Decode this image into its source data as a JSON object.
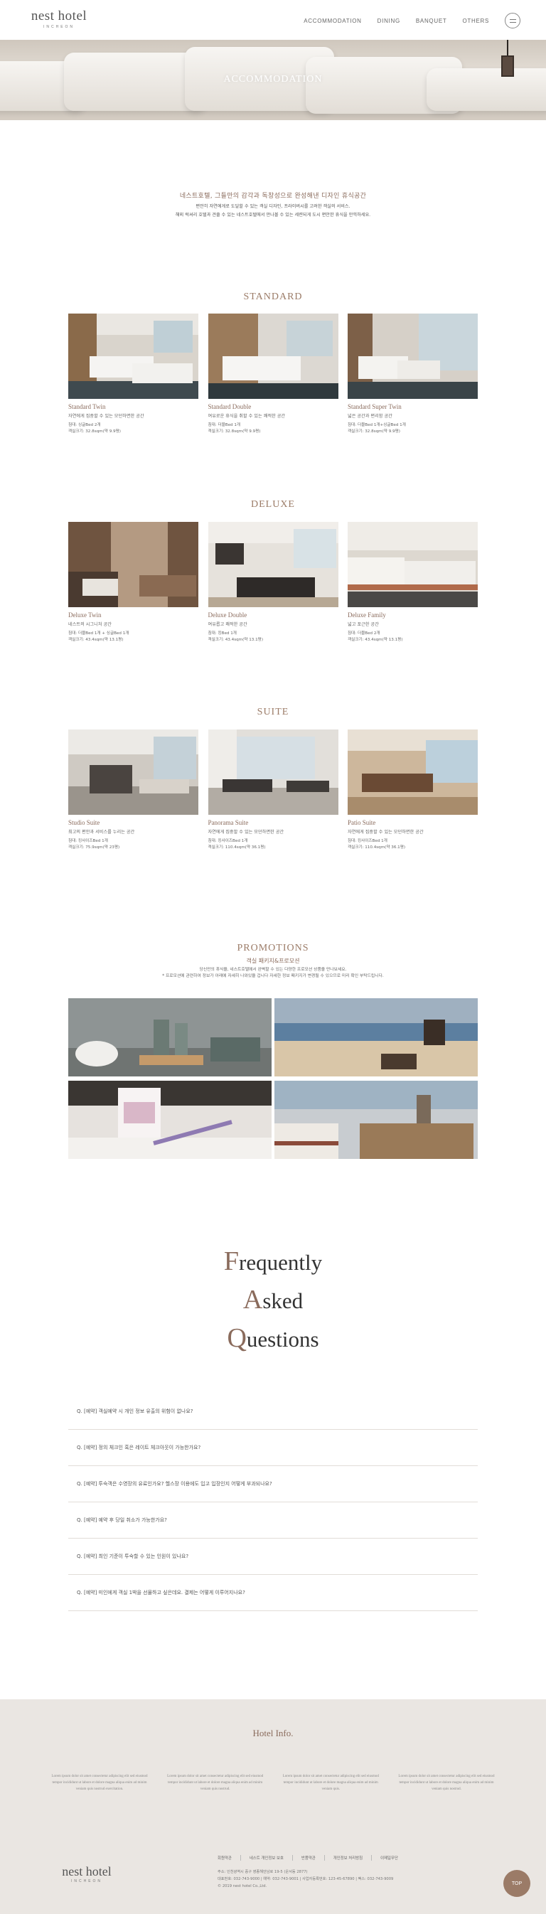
{
  "header": {
    "logo_name": "nest hotel",
    "logo_city": "INCHEON",
    "nav": [
      "ACCOMMODATION",
      "DINING",
      "BANQUET",
      "OTHERS"
    ]
  },
  "hero": {
    "title": "ACCOMMODATION"
  },
  "intro": {
    "heading": "네스트호텔, 그들만의 감각과 독창성으로 완성해낸 디자인 휴식공간",
    "line1": "편안히 자연에게로 도달할 수 있는 객실 디자인, 프라이버시를 고려한 객실의 서비스.",
    "line2": "해외 럭셔리 호텔과 견줄 수 있는 네스트호텔에서 만나볼 수 있는 세련되게 도시 편안한 휴식을 만끽하세요."
  },
  "sections": [
    {
      "title": "STANDARD",
      "rooms": [
        {
          "name": "Standard Twin",
          "desc": "자연에게 집중할 수 있는 모던하면한 공간",
          "bed": "침대: 싱글Bed 2개",
          "size": "객실크기: 32.8sqm(약 9.9평)"
        },
        {
          "name": "Standard Double",
          "desc": "여유로운 휴식을 취할 수 있는 쾌적한 공간",
          "bed": "침대: 더블Bed 1개",
          "size": "객실크기: 32.8sqm(약 9.9평)"
        },
        {
          "name": "Standard Super Twin",
          "desc": "넓은 공간과 편리함 공간",
          "bed": "침대: 더블Bed 1개+싱글Bed 1개",
          "size": "객실크기: 32.8sqm(약 9.9평)"
        }
      ]
    },
    {
      "title": "DELUXE",
      "rooms": [
        {
          "name": "Deluxe Twin",
          "desc": "네스트의 시그니처 공간",
          "bed": "침대: 더블Bed 1개 + 싱글Bed 1개",
          "size": "객실크기: 43.4sqm(약 13.1평)"
        },
        {
          "name": "Deluxe Double",
          "desc": "여유롭고 쾌적한 공간",
          "bed": "침대: 킹Bed 1개",
          "size": "객실크기: 43.4sqm(약 13.1평)"
        },
        {
          "name": "Deluxe Family",
          "desc": "넓고 포근한 공간",
          "bed": "침대: 더블Bed 2개",
          "size": "객실크기: 43.4sqm(약 13.1평)"
        }
      ]
    },
    {
      "title": "SUITE",
      "rooms": [
        {
          "name": "Studio Suite",
          "desc": "최고의 편안과 서비스를 누리는 공간",
          "bed": "침대: 킹사이즈Bed 1개",
          "size": "객실크기: 75.9sqm(약 23평)"
        },
        {
          "name": "Panorama Suite",
          "desc": "자연에게 집중할 수 있는 모던하면한 공간",
          "bed": "침대: 킹사이즈Bed 1개",
          "size": "객실크기: 110.4sqm(약 36.1평)"
        },
        {
          "name": "Patio Suite",
          "desc": "자연에게 집중할 수 있는 모던하면한 공간",
          "bed": "침대: 킹사이즈Bed 1개",
          "size": "객실크기: 110.4sqm(약 36.1평)"
        }
      ]
    }
  ],
  "promotions": {
    "title": "PROMOTIONS",
    "subtitle": "객실 패키지&프로모션",
    "line1": "당신만의 휴식을, 네스트호텔에서 완벽할 수 있는 다양한 프로모션 상품을 만나보세요.",
    "line2": "* 프로모션에 관련하여 정보가 아래에 자세히 나와있을 겁니다 자세한 정보 패키지가 변경될 수 있으므로 미리 확인 부탁드립니다."
  },
  "faq": {
    "title_lines": [
      {
        "cap": "F",
        "rest": "requently"
      },
      {
        "cap": "A",
        "rest": "sked"
      },
      {
        "cap": "Q",
        "rest": "uestions"
      }
    ],
    "items": [
      "Q. [예약] 객실예약 시 개인 정보 유출의 위험이 없나요?",
      "Q. [예약] 정의 체크인 혹은 레이트 체크아웃이 가능한가요?",
      "Q. [예약] 투숙객은 수영장의 유료인가요? 헬스장 이용에도 입고 입장인지 어떻게 부과되나요?",
      "Q. [예약] 예약 후 당일 취소가 가능한가요?",
      "Q. [예약] 최인 기준이 투숙할 수 있는 인원이 있나요?",
      "Q. [예약] 미인에게 객실 1박을 선물하고 싶은데요. 결제는 어떻게 이루어지나요?"
    ]
  },
  "footer": {
    "title": "Hotel Info.",
    "columns": [
      "Lorem ipsum dolor sit amet consectetur adipiscing elit sed eiusmod tempor incididunt ut labore et dolore magna aliqua enim ad minim veniam quis nostrud exercitation.",
      "Lorem ipsum dolor sit amet consectetur adipiscing elit sed eiusmod tempor incididunt ut labore et dolore magna aliqua enim ad minim veniam quis nostrud.",
      "Lorem ipsum dolor sit amet consectetur adipiscing elit sed eiusmod tempor incididunt ut labore et dolore magna aliqua enim ad minim veniam quis.",
      "Lorem ipsum dolor sit amet consectetur adipiscing elit sed eiusmod tempor incididunt ut labore et dolore magna aliqua enim ad minim veniam quis nostrud."
    ],
    "logo_name": "nest hotel",
    "logo_city": "INCHEON",
    "links": [
      "회원약관",
      "네스트 개인정보 보호",
      "반품약관",
      "개인정보 처리방침",
      "이메일무단"
    ],
    "info1": "주소: 인천광역시 중구 영종해안남로 19-5 (운서동 2877)",
    "info2": "대표번호: 032-743-9000 | 예약: 032-743-9001 | 사업자등록번호: 123-45-67890 | 팩스: 032-743-9009",
    "info3": "© 2019 nest hotel Co.,Ltd.",
    "top_label": "TOP"
  }
}
